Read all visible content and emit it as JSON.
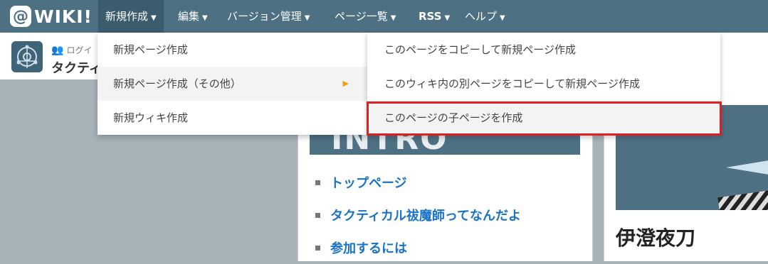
{
  "logo": {
    "mark": "@",
    "text": "WIKI!"
  },
  "nav": {
    "items": [
      {
        "label": "新規作成",
        "caret": "▼"
      },
      {
        "label": "編集",
        "caret": "▼"
      },
      {
        "label": "バージョン管理",
        "caret": "▼"
      },
      {
        "label": "ページ一覧",
        "caret": "▼"
      },
      {
        "label": "RSS",
        "caret": "▼"
      },
      {
        "label": "ヘルプ",
        "caret": "▼"
      }
    ]
  },
  "subbar": {
    "login": "ログイ",
    "site_title": "タクティ"
  },
  "menu_new": {
    "items": [
      {
        "label": "新規ページ作成"
      },
      {
        "label": "新規ページ作成（その他）"
      },
      {
        "label": "新規ウィキ作成"
      }
    ],
    "submenu_arrow": "▶"
  },
  "submenu_other": {
    "items": [
      {
        "label": "このページをコピーして新規ページ作成"
      },
      {
        "label": "このウィキ内の別ページをコピーして新規ページ作成"
      },
      {
        "label": "このページの子ページを作成"
      }
    ]
  },
  "content": {
    "intro_banner": "INTRO",
    "links": [
      "トップページ",
      "タクティカル祓魔師ってなんだよ",
      "参加するには"
    ],
    "character_name": "伊澄夜刀"
  },
  "colors": {
    "nav_bg": "#4d7083",
    "link": "#1a73c9",
    "highlight_border": "#e02020",
    "submenu_arrow": "#f39c12"
  }
}
